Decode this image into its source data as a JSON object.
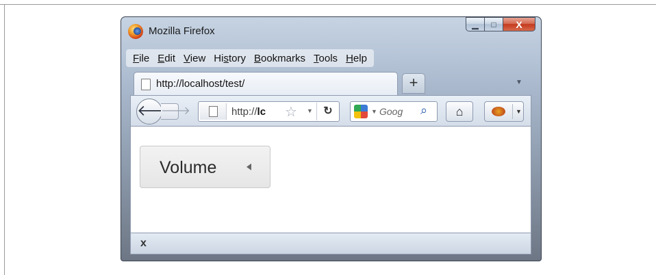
{
  "window": {
    "title": "Mozilla Firefox"
  },
  "caption_buttons": {
    "minimize": "▁",
    "maximize": "□",
    "close": "X"
  },
  "menu": [
    {
      "label": "File"
    },
    {
      "label": "Edit"
    },
    {
      "label": "View"
    },
    {
      "label": "History"
    },
    {
      "label": "Bookmarks"
    },
    {
      "label": "Tools"
    },
    {
      "label": "Help"
    }
  ],
  "tab": {
    "title": "http://localhost/test/"
  },
  "new_tab_label": "+",
  "urlbar": {
    "prefix": "http://",
    "host_visible": "lc"
  },
  "search": {
    "engine_text": "Goog"
  },
  "content": {
    "volume_button_label": "Volume"
  },
  "addon_bar": {
    "close_label": "x"
  }
}
